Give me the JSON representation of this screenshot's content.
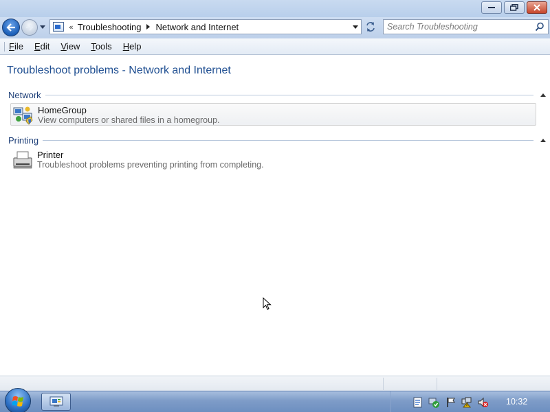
{
  "address_bar": {
    "chevron": "«",
    "breadcrumbs": [
      "Troubleshooting",
      "Network and Internet"
    ]
  },
  "search": {
    "placeholder": "Search Troubleshooting"
  },
  "menu": {
    "items": [
      {
        "key": "F",
        "rest": "ile"
      },
      {
        "key": "E",
        "rest": "dit"
      },
      {
        "key": "V",
        "rest": "iew"
      },
      {
        "key": "T",
        "rest": "ools"
      },
      {
        "key": "H",
        "rest": "elp"
      }
    ]
  },
  "page_title": "Troubleshoot problems - Network and Internet",
  "groups": [
    {
      "label": "Network",
      "items": [
        {
          "title": "HomeGroup",
          "description": "View computers or shared files in a homegroup.",
          "icon": "homegroup-icon"
        }
      ]
    },
    {
      "label": "Printing",
      "items": [
        {
          "title": "Printer",
          "description": "Troubleshoot problems preventing printing from completing.",
          "icon": "printer-icon"
        }
      ]
    }
  ],
  "taskbar": {
    "clock": "10:32"
  },
  "colors": {
    "title_blue": "#1e4e91",
    "group_blue": "#1e3f78",
    "taskbar": "#7e9cc8"
  }
}
